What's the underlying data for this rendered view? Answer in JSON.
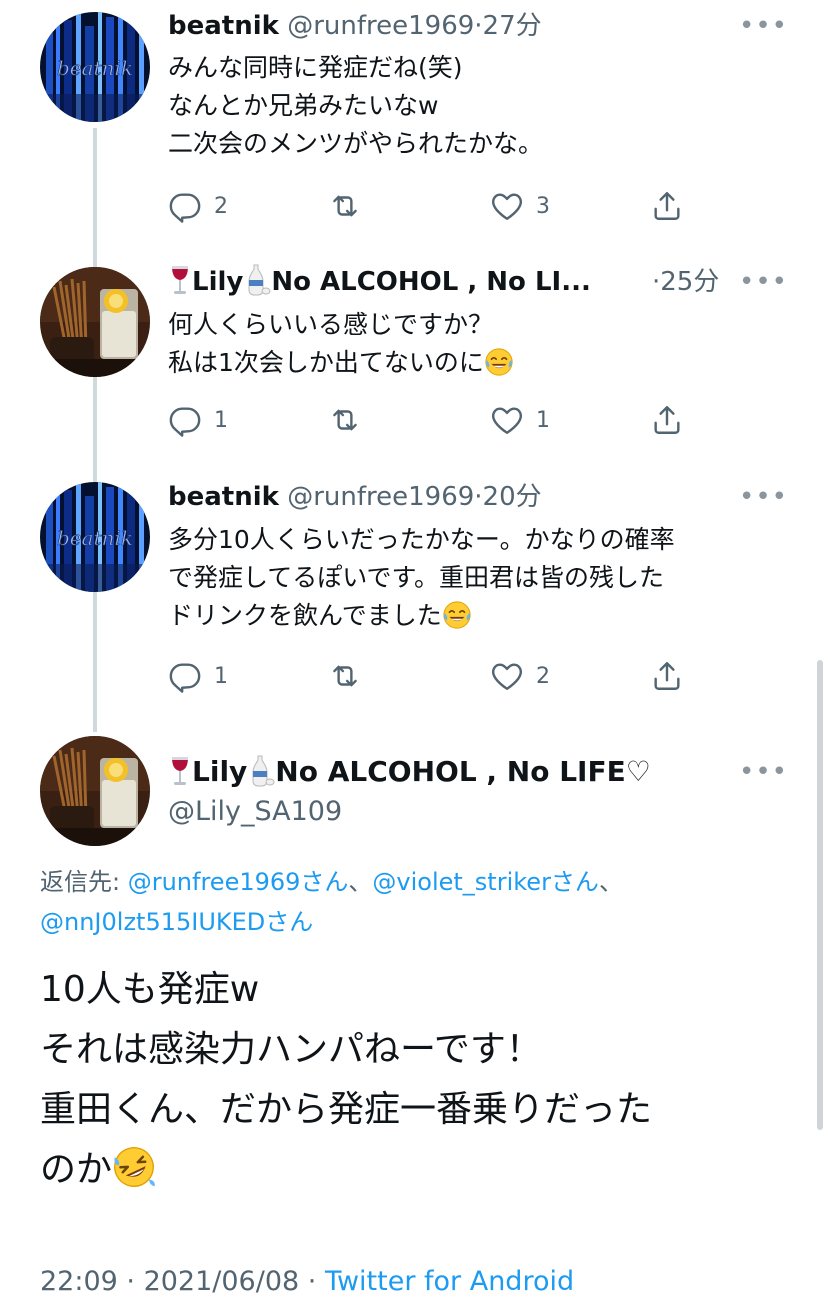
{
  "tweets": [
    {
      "name": "beatnik",
      "handle": "@runfree1969",
      "sep": "·",
      "time": "27分",
      "lines": [
        "みんな同時に発症だね(笑)",
        "なんとか兄弟みたいなw",
        "二次会のメンツがやられたかな。"
      ],
      "replies": "2",
      "retweets": "",
      "likes": "3",
      "avatar": "beatnik-avatar"
    },
    {
      "name": "Lily",
      "name_suffix": "No ALCOHOL , No LI...",
      "sep": "·",
      "time": "25分",
      "lines": [
        "何人くらいいる感じですか？",
        "私は1次会しか出てないのに"
      ],
      "replies": "1",
      "retweets": "",
      "likes": "1",
      "avatar": "lily-avatar"
    },
    {
      "name": "beatnik",
      "handle": "@runfree1969",
      "sep": "·",
      "time": "20分",
      "lines": [
        "多分10人くらいだったかなー。かなりの確率",
        "で発症してるぽいです。重田君は皆の残した",
        "ドリンクを飲んでました"
      ],
      "replies": "1",
      "retweets": "",
      "likes": "2",
      "avatar": "beatnik-avatar"
    }
  ],
  "focus": {
    "name": "Lily",
    "name_suffix": "No ALCOHOL , No LIFE♡",
    "handle": "@Lily_SA109",
    "reply_label": "返信先: ",
    "reply_1": "@runfree1969さん",
    "reply_sep_1": "、",
    "reply_2": "@violet_strikerさん",
    "reply_sep_2": "、",
    "reply_3": "@nnJ0lzt515IUKEDさん",
    "lines": [
      "10人も発症w",
      "それは感染力ハンパねーです！",
      "重田くん、だから発症一番乗りだった",
      "のか"
    ],
    "time": "22:09",
    "sep": " · ",
    "date": "2021/06/08",
    "sep2": " · ",
    "source": "Twitter for Android"
  },
  "icons": {
    "more": "more-icon",
    "reply": "reply-icon",
    "retweet": "retweet-icon",
    "like": "heart-icon",
    "share": "share-icon",
    "wine": "wine-glass-icon",
    "sake": "sake-bottle-icon",
    "laugh": "tears-of-joy-emoji",
    "rofl": "rolling-on-floor-laughing-emoji"
  },
  "colors": {
    "link": "#1d9bf0",
    "muted": "#536471",
    "text": "#0f1419",
    "line": "#cfd9de"
  },
  "more_glyph": "•••"
}
